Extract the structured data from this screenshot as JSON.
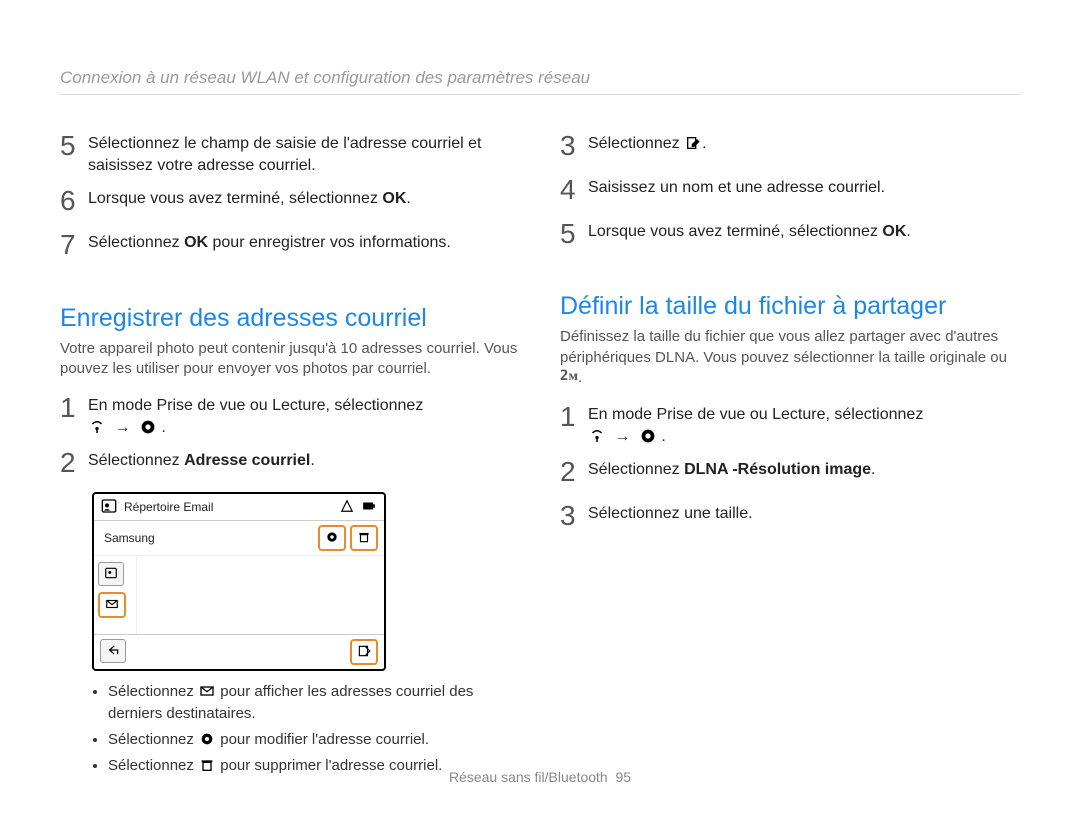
{
  "section_title": "Connexion à un réseau WLAN et configuration des paramètres réseau",
  "left": {
    "top_steps": [
      {
        "num": "5",
        "text": "Sélectionnez le champ de saisie de l'adresse courriel et saisissez votre adresse courriel."
      },
      {
        "num": "6",
        "pre": "Lorsque vous avez terminé, sélectionnez ",
        "bold": "OK",
        "post": "."
      },
      {
        "num": "7",
        "pre": "Sélectionnez ",
        "bold": "OK",
        "post": " pour enregistrer vos informations."
      }
    ],
    "heading": "Enregistrer des adresses courriel",
    "desc": "Votre appareil photo peut contenir jusqu'à 10 adresses courriel. Vous pouvez les utiliser pour envoyer vos photos par courriel.",
    "steps": [
      {
        "num": "1",
        "text": "En mode Prise de vue ou Lecture, sélectionnez",
        "with_icons": true
      },
      {
        "num": "2",
        "pre": "Sélectionnez ",
        "bold": "Adresse courriel",
        "post": "."
      }
    ],
    "shot": {
      "title": "Répertoire Email",
      "item": "Samsung"
    },
    "bullets": [
      {
        "pre": "Sélectionnez ",
        "icon": "envelope-x-icon",
        "post": " pour afficher les adresses courriel des derniers destinataires."
      },
      {
        "pre": "Sélectionnez ",
        "icon": "gear-icon",
        "post": " pour modifier l'adresse courriel."
      },
      {
        "pre": "Sélectionnez ",
        "icon": "trash-icon",
        "post": " pour supprimer l'adresse courriel."
      }
    ]
  },
  "right": {
    "top_steps": [
      {
        "num": "3",
        "pre": "Sélectionnez ",
        "icon": "compose-icon",
        "post": "."
      },
      {
        "num": "4",
        "text": "Saisissez un nom et une adresse courriel."
      },
      {
        "num": "5",
        "pre": "Lorsque vous avez terminé, sélectionnez ",
        "bold": "OK",
        "post": "."
      }
    ],
    "heading": "Définir la taille du fichier à partager",
    "desc_pre": "Définissez la taille du fichier que vous allez partager avec d'autres périphériques DLNA. Vous pouvez sélectionner la taille originale ou ",
    "desc_icon": "size-2m-icon",
    "desc_post": ".",
    "steps": [
      {
        "num": "1",
        "text": "En mode Prise de vue ou Lecture, sélectionnez",
        "with_icons": true
      },
      {
        "num": "2",
        "pre": "Sélectionnez ",
        "bold": "DLNA -Résolution image",
        "post": "."
      },
      {
        "num": "3",
        "text": "Sélectionnez une taille."
      }
    ]
  },
  "footer": {
    "label": "Réseau sans fil/Bluetooth",
    "page": "95"
  }
}
